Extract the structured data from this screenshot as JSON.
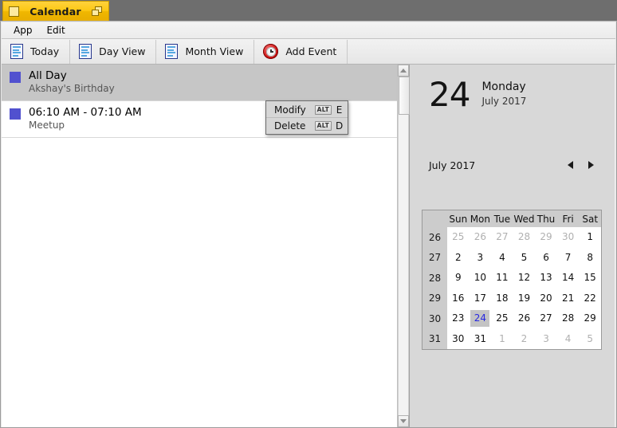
{
  "window": {
    "title": "Calendar",
    "app_icon": "app-square-icon",
    "restore_icon": "restore-windows-icon"
  },
  "menubar": {
    "items": [
      {
        "label": "App"
      },
      {
        "label": "Edit"
      }
    ]
  },
  "toolbar": {
    "buttons": [
      {
        "label": "Today",
        "icon": "document-icon"
      },
      {
        "label": "Day View",
        "icon": "document-icon"
      },
      {
        "label": "Month View",
        "icon": "document-icon"
      },
      {
        "label": "Add Event",
        "icon": "alarm-clock-icon"
      }
    ]
  },
  "events": {
    "swatch_color": "#5151cf",
    "items": [
      {
        "time": "All Day",
        "title": "Akshay's Birthday",
        "selected": true
      },
      {
        "time": "06:10 AM - 07:10 AM",
        "title": "Meetup",
        "selected": false
      }
    ]
  },
  "context_menu": {
    "items": [
      {
        "label": "Modify",
        "modifier": "ALT",
        "key": "E"
      },
      {
        "label": "Delete",
        "modifier": "ALT",
        "key": "D"
      }
    ]
  },
  "date_panel": {
    "day_number": "24",
    "weekday": "Monday",
    "month_year": "July 2017",
    "nav_label": "July 2017",
    "prev_icon": "triangle-left-icon",
    "next_icon": "triangle-right-icon"
  },
  "mini_calendar": {
    "weekday_headers": [
      "Sun",
      "Mon",
      "Tue",
      "Wed",
      "Thu",
      "Fri",
      "Sat"
    ],
    "selected_day": 24,
    "highlight_color": "#2727e0",
    "highlight_bg": "#c4c4c4",
    "weeks": [
      {
        "week": "26",
        "days": [
          {
            "d": "25",
            "other": true
          },
          {
            "d": "26",
            "other": true
          },
          {
            "d": "27",
            "other": true
          },
          {
            "d": "28",
            "other": true
          },
          {
            "d": "29",
            "other": true
          },
          {
            "d": "30",
            "other": true
          },
          {
            "d": "1",
            "other": false
          }
        ]
      },
      {
        "week": "27",
        "days": [
          {
            "d": "2",
            "other": false
          },
          {
            "d": "3",
            "other": false
          },
          {
            "d": "4",
            "other": false
          },
          {
            "d": "5",
            "other": false
          },
          {
            "d": "6",
            "other": false
          },
          {
            "d": "7",
            "other": false
          },
          {
            "d": "8",
            "other": false
          }
        ]
      },
      {
        "week": "28",
        "days": [
          {
            "d": "9",
            "other": false
          },
          {
            "d": "10",
            "other": false
          },
          {
            "d": "11",
            "other": false
          },
          {
            "d": "12",
            "other": false
          },
          {
            "d": "13",
            "other": false
          },
          {
            "d": "14",
            "other": false
          },
          {
            "d": "15",
            "other": false
          }
        ]
      },
      {
        "week": "29",
        "days": [
          {
            "d": "16",
            "other": false
          },
          {
            "d": "17",
            "other": false
          },
          {
            "d": "18",
            "other": false
          },
          {
            "d": "19",
            "other": false
          },
          {
            "d": "20",
            "other": false
          },
          {
            "d": "21",
            "other": false
          },
          {
            "d": "22",
            "other": false
          }
        ]
      },
      {
        "week": "30",
        "days": [
          {
            "d": "23",
            "other": false
          },
          {
            "d": "24",
            "other": false,
            "today": true
          },
          {
            "d": "25",
            "other": false
          },
          {
            "d": "26",
            "other": false
          },
          {
            "d": "27",
            "other": false
          },
          {
            "d": "28",
            "other": false
          },
          {
            "d": "29",
            "other": false
          }
        ]
      },
      {
        "week": "31",
        "days": [
          {
            "d": "30",
            "other": false
          },
          {
            "d": "31",
            "other": false
          },
          {
            "d": "1",
            "other": true
          },
          {
            "d": "2",
            "other": true
          },
          {
            "d": "3",
            "other": true
          },
          {
            "d": "4",
            "other": true
          },
          {
            "d": "5",
            "other": true
          }
        ]
      }
    ]
  },
  "scrollbar": {
    "up_icon": "scroll-up-arrow-icon",
    "down_icon": "scroll-down-arrow-icon"
  }
}
